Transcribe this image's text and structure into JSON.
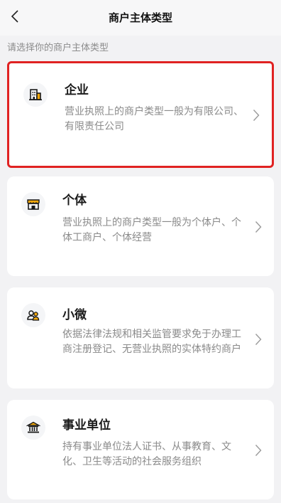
{
  "header": {
    "title": "商户主体类型"
  },
  "subtitle": "请选择你的商户主体类型",
  "options": [
    {
      "title": "企业",
      "description": "营业执照上的商户类型一般为有限公司、有限责任公司",
      "icon": "building-icon",
      "selected": true
    },
    {
      "title": "个体",
      "description": "营业执照上的商户类型一般为个体户、个体工商户、个体经营",
      "icon": "storefront-icon",
      "selected": false
    },
    {
      "title": "小微",
      "description": "依据法律法规和相关监管要求免于办理工商注册登记、无营业执照的实体特约商户",
      "icon": "people-icon",
      "selected": false
    },
    {
      "title": "事业单位",
      "description": "持有事业单位法人证书、从事教育、文化、卫生等活动的社会服务组织",
      "icon": "institution-icon",
      "selected": false
    }
  ],
  "colors": {
    "selected_border": "#e02222",
    "accent": "#f2a80c"
  }
}
